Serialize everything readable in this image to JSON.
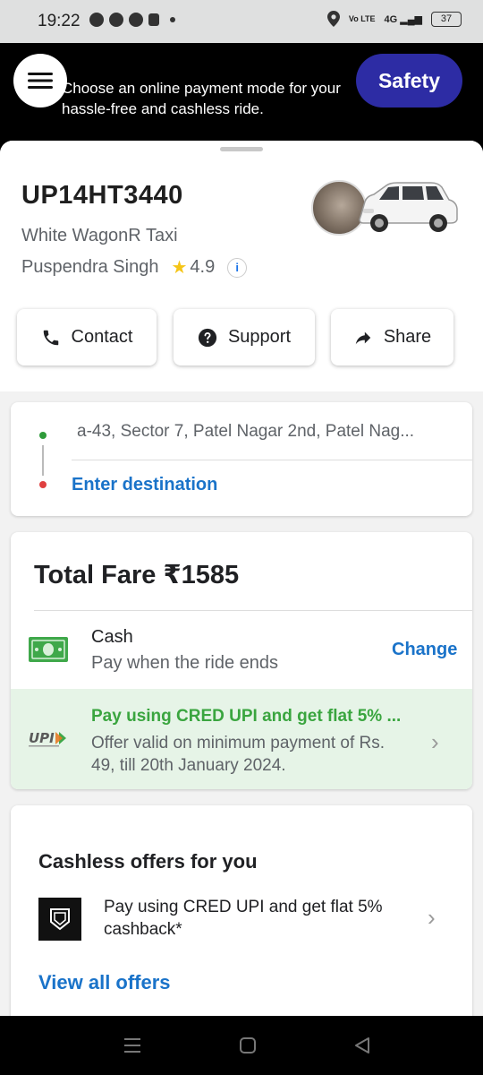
{
  "status_bar": {
    "time": "19:22",
    "network_label": "Vo LTE",
    "signal_label": "4G",
    "battery": "37"
  },
  "banner": {
    "message_line1": "Choose an online payment mode for your",
    "message_line2": "hassle-free and cashless ride.",
    "safety_label": "Safety",
    "safety_color": "#2d2ca4"
  },
  "ride": {
    "plate": "UP14HT3440",
    "car_description": "White WagonR Taxi",
    "driver_name": "Puspendra Singh",
    "rating": "4.9",
    "info_icon": "i"
  },
  "actions": {
    "contact": "Contact",
    "support": "Support",
    "share": "Share"
  },
  "route": {
    "pickup": "a-43, Sector 7, Patel Nagar 2nd, Patel Nag...",
    "destination_placeholder": "Enter destination"
  },
  "fare": {
    "title": "Total Fare ₹1585",
    "method_title": "Cash",
    "method_subtitle": "Pay when the ride ends",
    "change_label": "Change"
  },
  "upi_offer": {
    "title": "Pay using CRED UPI and get flat 5% ...",
    "subtitle": "Offer valid on minimum payment of Rs. 49, till 20th January 2024.",
    "accent": "#3aa53f"
  },
  "offers": {
    "title": "Cashless offers for you",
    "cred_offer": "Pay using CRED UPI and get flat 5% cashback*",
    "view_all": "View all offers"
  },
  "colors": {
    "link": "#1a73c9",
    "star": "#f5c518"
  }
}
